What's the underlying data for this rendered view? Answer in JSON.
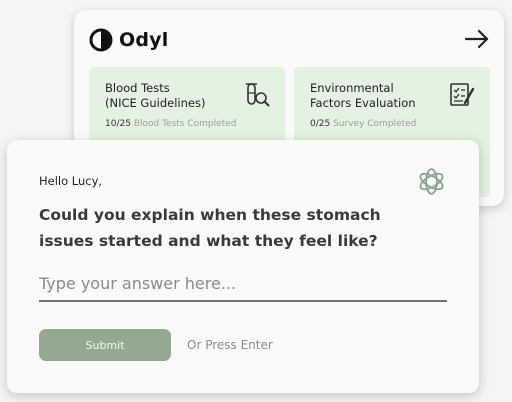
{
  "app": {
    "brand": "Odyl",
    "next_icon": "arrow-right-icon"
  },
  "tasks": [
    {
      "title": "Blood Tests\n(NICE Guidelines)",
      "progress_count": "10/25",
      "progress_label": "Blood Tests Completed",
      "icon": "test-tube-magnifier-icon"
    },
    {
      "title": "Environmental\nFactors Evaluation",
      "progress_count": "0/25",
      "progress_label": "Survey Completed",
      "icon": "checklist-pencil-icon"
    }
  ],
  "chat": {
    "greeting": "Hello Lucy,",
    "question": "Could you explain when these stomach issues started and what they feel like?",
    "ai_icon": "openai-logo-icon",
    "input": {
      "value": "",
      "placeholder": "Type your answer here..."
    },
    "submit_label": "Submit",
    "enter_hint": "Or Press Enter"
  },
  "colors": {
    "task_card_bg": "#e4f2e1",
    "submit_bg": "#93aa91",
    "page_bg": "#f5f5f4"
  }
}
